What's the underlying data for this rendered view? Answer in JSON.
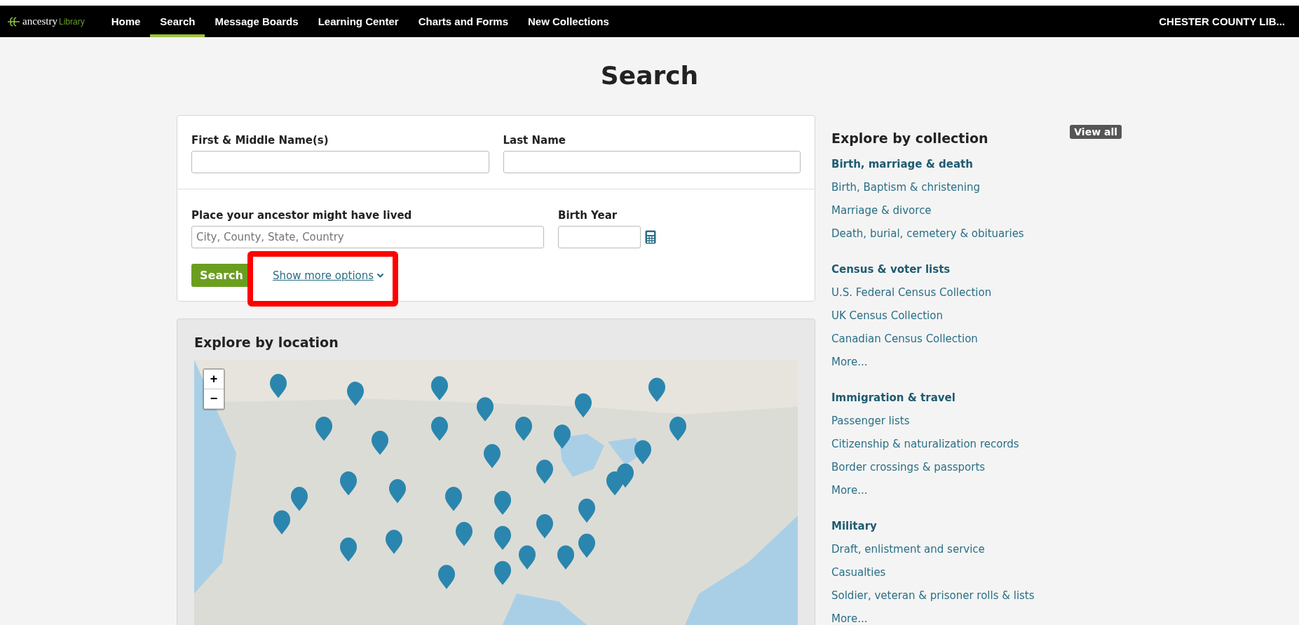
{
  "header": {
    "logo": {
      "brand": "ancestry",
      "product": "Library"
    },
    "nav": [
      {
        "label": "Home",
        "selected": false
      },
      {
        "label": "Search",
        "selected": true
      },
      {
        "label": "Message Boards",
        "selected": false
      },
      {
        "label": "Learning Center",
        "selected": false
      },
      {
        "label": "Charts and Forms",
        "selected": false
      },
      {
        "label": "New Collections",
        "selected": false
      }
    ],
    "account": "CHESTER COUNTY LIB..."
  },
  "title": "Search",
  "search_form": {
    "names": [
      {
        "label": "First & Middle Name(s)"
      },
      {
        "label": "Last Name"
      }
    ],
    "place": {
      "label": "Place your ancestor might have lived",
      "placeholder": "City, County, State, Country"
    },
    "birth_year": {
      "label": "Birth Year"
    },
    "search_button": "Search",
    "more_options": "Show more options"
  },
  "location": {
    "title": "Explore by location",
    "zoom_in": "+",
    "zoom_out": "−"
  },
  "collections": {
    "title": "Explore by collection",
    "view_all": "View all",
    "groups": [
      {
        "title": "Birth, marriage & death",
        "links": [
          "Birth, Baptism & christening",
          "Marriage & divorce",
          "Death, burial, cemetery & obituaries"
        ]
      },
      {
        "title": "Census & voter lists",
        "links": [
          "U.S. Federal Census Collection",
          "UK Census Collection",
          "Canadian Census Collection",
          "More..."
        ]
      },
      {
        "title": "Immigration & travel",
        "links": [
          "Passenger lists",
          "Citizenship & naturalization records",
          "Border crossings & passports",
          "More..."
        ]
      },
      {
        "title": "Military",
        "links": [
          "Draft, enlistment and service",
          "Casualties",
          "Soldier, veteran & prisoner rolls & lists",
          "More..."
        ]
      }
    ]
  }
}
